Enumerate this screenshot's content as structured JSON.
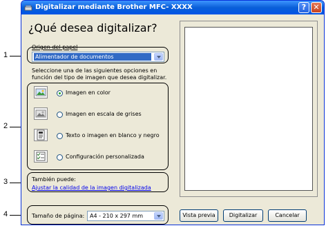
{
  "window": {
    "title": "Digitalizar mediante Brother MFC- XXXX",
    "help_label": "?",
    "close_label": "✕"
  },
  "main": {
    "heading": "¿Qué desea digitalizar?",
    "source_label": "Origen del papel",
    "source_value": "Alimentador de documentos",
    "instructions": "Seleccione una de las siguientes opciones en función del tipo de imagen que desea digitalizar.",
    "options": [
      {
        "label": "Imagen en color",
        "icon": "color-image-icon",
        "selected": true
      },
      {
        "label": "Imagen en escala de grises",
        "icon": "grayscale-image-icon",
        "selected": false
      },
      {
        "label": "Texto o imagen en blanco y negro",
        "icon": "bw-text-icon",
        "selected": false
      },
      {
        "label": "Configuración personalizada",
        "icon": "custom-settings-icon",
        "selected": false
      }
    ],
    "also_label": "También puede:",
    "adjust_link": "Ajustar la calidad de la imagen digitalizada",
    "page_size_label": "Tamaño de página:",
    "page_size_value": "A4 - 210 x 297 mm"
  },
  "buttons": {
    "preview": "Vista previa",
    "scan": "Digitalizar",
    "cancel": "Cancelar"
  },
  "callouts": [
    "1",
    "2",
    "3",
    "4"
  ]
}
